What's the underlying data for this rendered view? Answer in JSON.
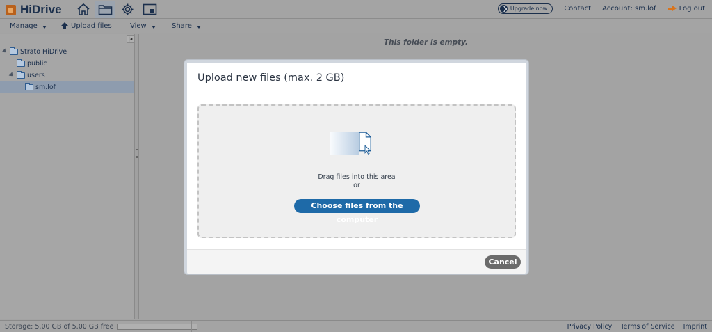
{
  "header": {
    "app_name": "HiDrive",
    "upgrade_label": "Upgrade now",
    "contact_label": "Contact",
    "account_label": "Account: sm.lof",
    "logout_label": "Log out",
    "nav_icons": [
      "home-icon",
      "folder-icon",
      "gear-icon",
      "picture-frame-icon"
    ],
    "active_nav": "folder-icon"
  },
  "toolbar": {
    "manage_label": "Manage",
    "upload_label": "Upload files",
    "view_label": "View",
    "share_label": "Share"
  },
  "tree": {
    "root": "Strato HiDrive",
    "public": "public",
    "users": "users",
    "selected": "sm.lof"
  },
  "content": {
    "empty_message": "This folder is empty."
  },
  "dialog": {
    "title": "Upload new files (max. 2 GB)",
    "drag_text": "Drag files into this area",
    "or_text": "or",
    "choose_button": "Choose files from the computer",
    "cancel_button": "Cancel"
  },
  "footer": {
    "storage_text": "Storage: 5.00 GB of 5.00 GB free",
    "storage_used_fraction": 0,
    "privacy_label": "Privacy Policy",
    "terms_label": "Terms of Service",
    "imprint_label": "Imprint"
  },
  "colors": {
    "brand_navy": "#1b2f4c",
    "primary_button": "#1e6aa8",
    "logout_arrow": "#d8741d",
    "overlay_gray": "#a3a3a3"
  }
}
